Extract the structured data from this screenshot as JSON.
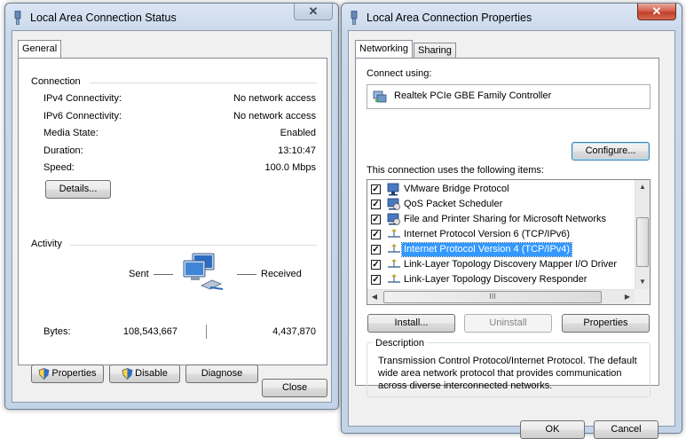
{
  "status_window": {
    "title": "Local Area Connection Status",
    "tab": "General",
    "connection": {
      "heading": "Connection",
      "rows": [
        {
          "label": "IPv4 Connectivity:",
          "value": "No network access"
        },
        {
          "label": "IPv6 Connectivity:",
          "value": "No network access"
        },
        {
          "label": "Media State:",
          "value": "Enabled"
        },
        {
          "label": "Duration:",
          "value": "13:10:47"
        },
        {
          "label": "Speed:",
          "value": "100.0 Mbps"
        }
      ],
      "details_button": "Details..."
    },
    "activity": {
      "heading": "Activity",
      "sent_label": "Sent",
      "received_label": "Received",
      "bytes_label": "Bytes:",
      "bytes_sent": "108,543,667",
      "bytes_received": "4,437,870",
      "icon": "network-computers-icon"
    },
    "buttons": {
      "properties": "Properties",
      "disable": "Disable",
      "diagnose": "Diagnose",
      "close": "Close"
    }
  },
  "properties_window": {
    "title": "Local Area Connection Properties",
    "tabs": [
      "Networking",
      "Sharing"
    ],
    "connect_using_label": "Connect using:",
    "adapter_name": "Realtek PCIe GBE Family Controller",
    "configure_button": "Configure...",
    "items_label": "This connection uses the following items:",
    "items": [
      {
        "label": "VMware Bridge Protocol",
        "checked": true,
        "icon": "client-icon"
      },
      {
        "label": "QoS Packet Scheduler",
        "checked": true,
        "icon": "service-icon"
      },
      {
        "label": "File and Printer Sharing for Microsoft Networks",
        "checked": true,
        "icon": "service-icon"
      },
      {
        "label": "Internet Protocol Version 6 (TCP/IPv6)",
        "checked": true,
        "icon": "protocol-icon"
      },
      {
        "label": "Internet Protocol Version 4 (TCP/IPv4)",
        "checked": true,
        "icon": "protocol-icon",
        "selected": true
      },
      {
        "label": "Link-Layer Topology Discovery Mapper I/O Driver",
        "checked": true,
        "icon": "protocol-icon"
      },
      {
        "label": "Link-Layer Topology Discovery Responder",
        "checked": true,
        "icon": "protocol-icon"
      }
    ],
    "install_button": "Install...",
    "uninstall_button": "Uninstall",
    "properties_button": "Properties",
    "description_heading": "Description",
    "description_text": "Transmission Control Protocol/Internet Protocol. The default wide area network protocol that provides communication across diverse interconnected networks.",
    "ok_button": "OK",
    "cancel_button": "Cancel"
  },
  "colors": {
    "selection": "#3399ff",
    "title_gradient_top": "#dbe6f4",
    "close_red": "#c0402b"
  }
}
